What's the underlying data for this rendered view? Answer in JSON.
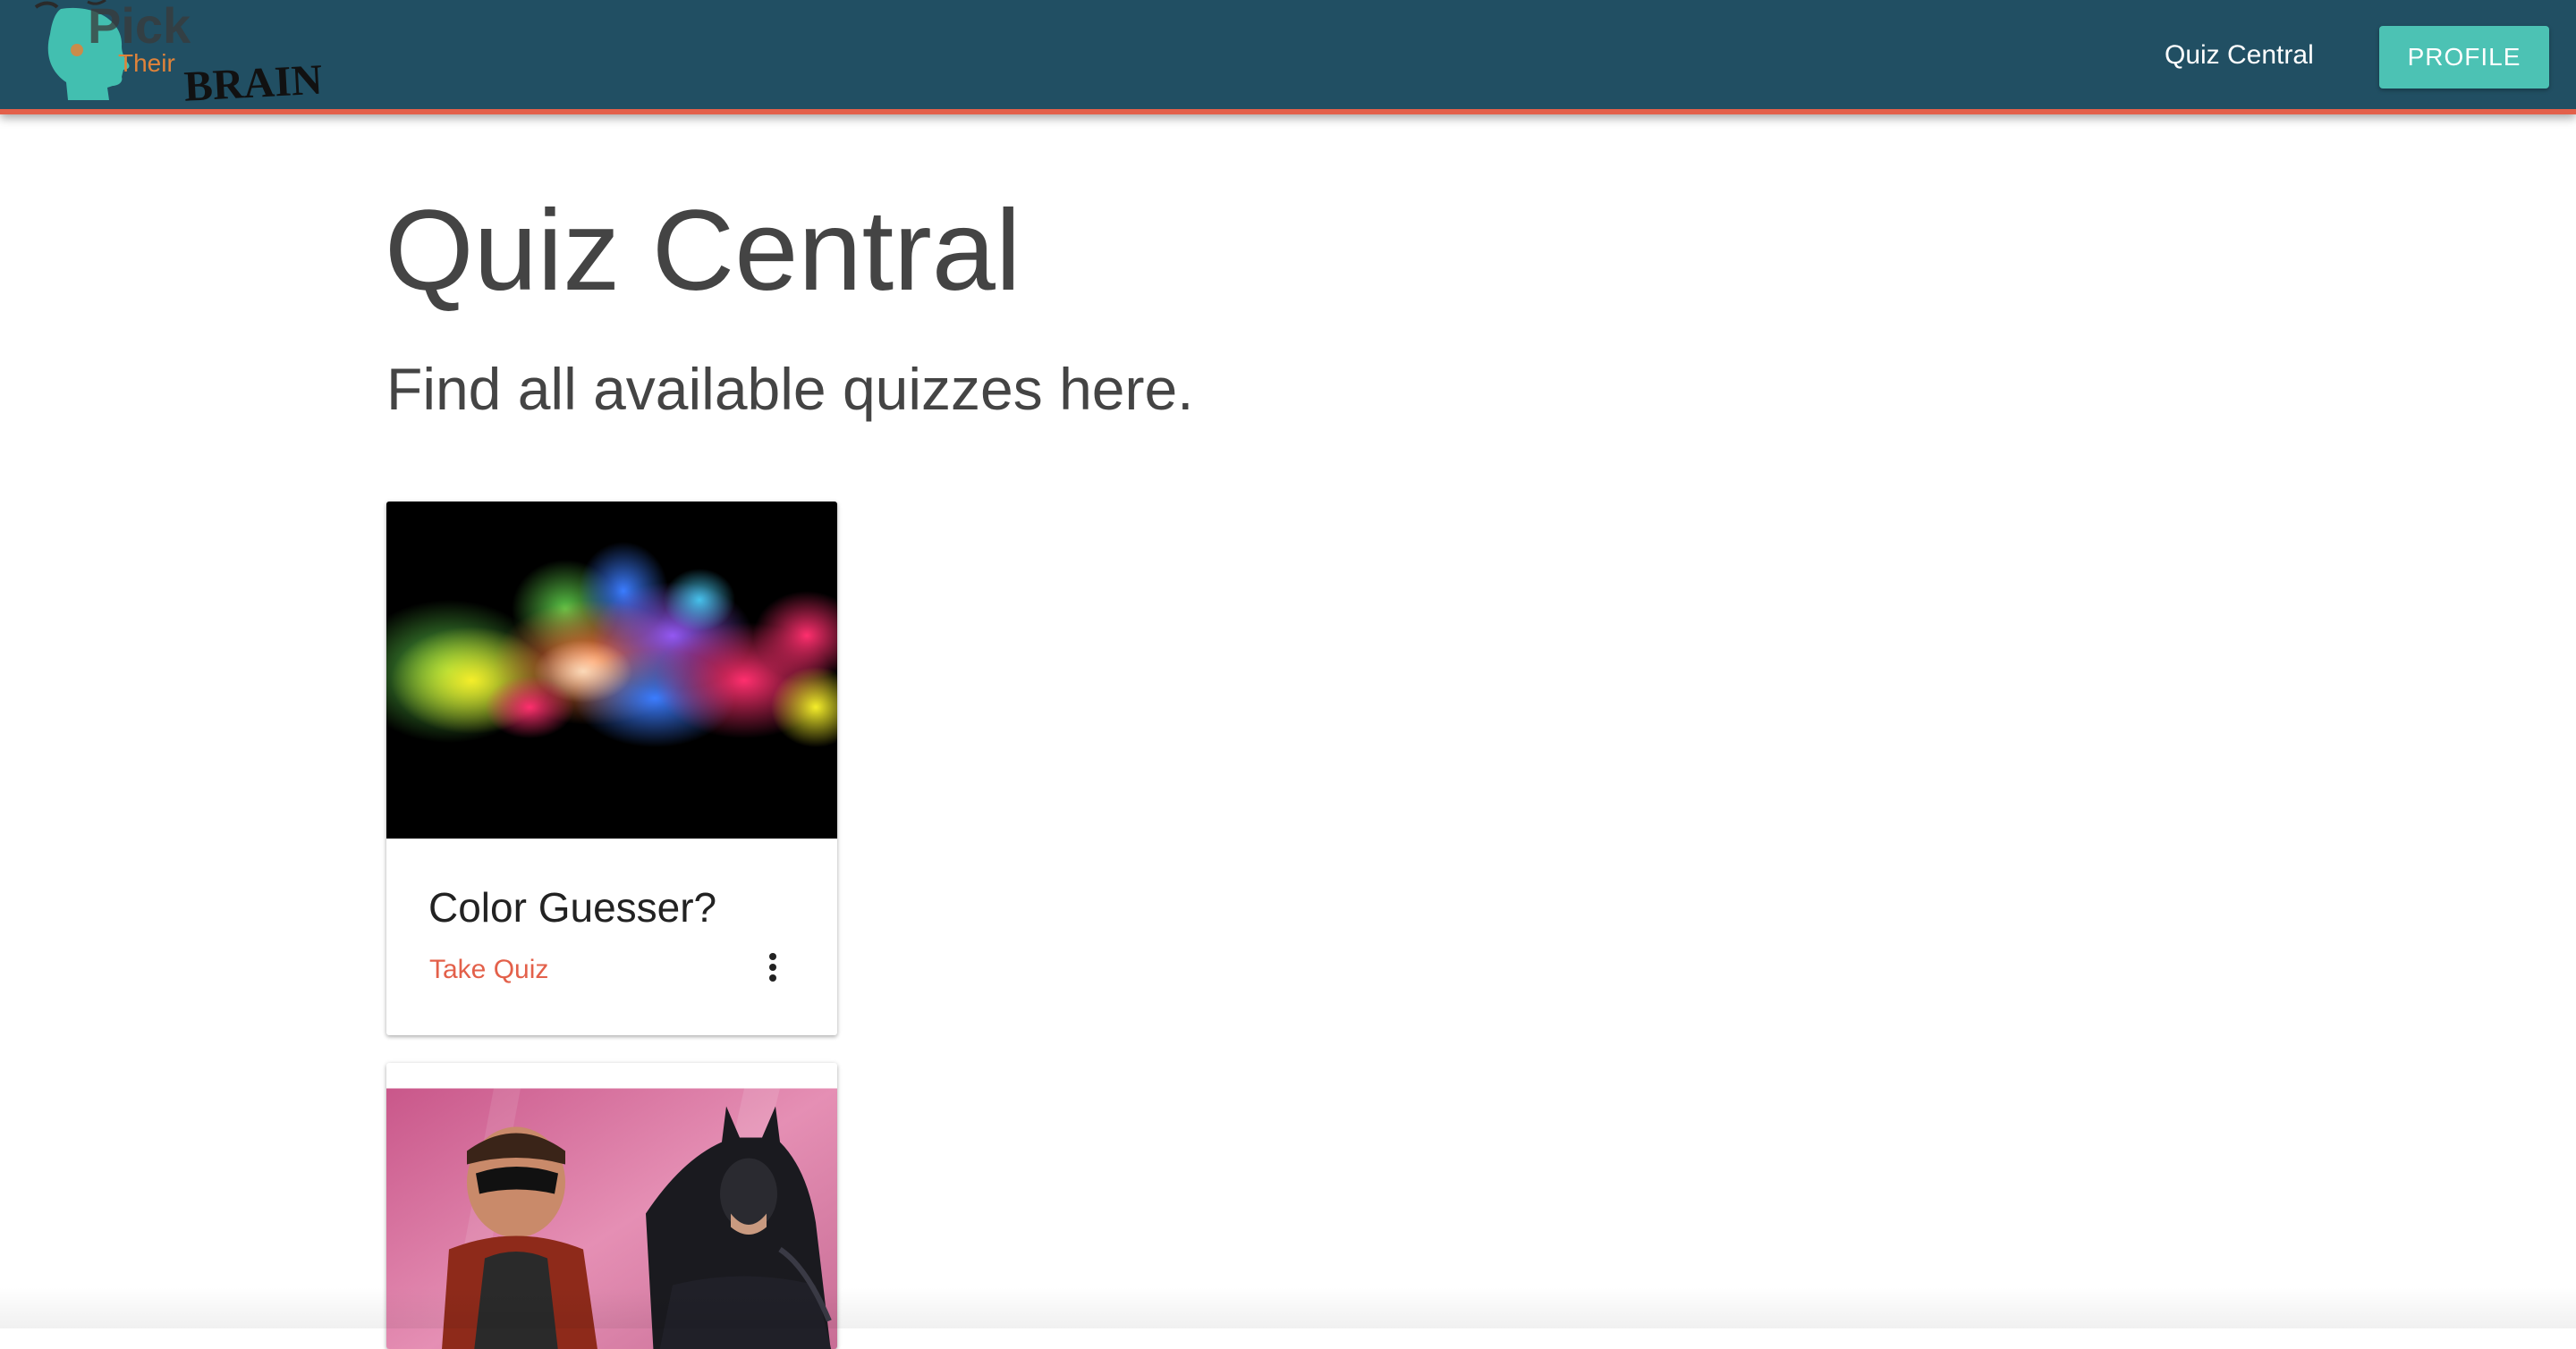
{
  "navbar": {
    "logo": {
      "word_pick": "Pick",
      "word_their": "Their",
      "word_brain": "BRAIN",
      "icon": "head-silhouette-icon"
    },
    "links": [
      {
        "label": "Quiz Central"
      }
    ],
    "profile_label": "PROFILE",
    "colors": {
      "background": "#214f63",
      "accent_border": "#e3604a",
      "profile_button": "#4cc2b4"
    }
  },
  "main": {
    "title": "Quiz Central",
    "subtitle": "Find all available quizzes here."
  },
  "quizzes": [
    {
      "title": "Color Guesser?",
      "action_label": "Take Quiz",
      "menu_icon": "more-vert-icon",
      "image": "color-powder-explosion"
    },
    {
      "title": "",
      "image": "superhero-duo-photo"
    }
  ],
  "colors": {
    "link_accent": "#e3604a",
    "text": "#444444"
  }
}
